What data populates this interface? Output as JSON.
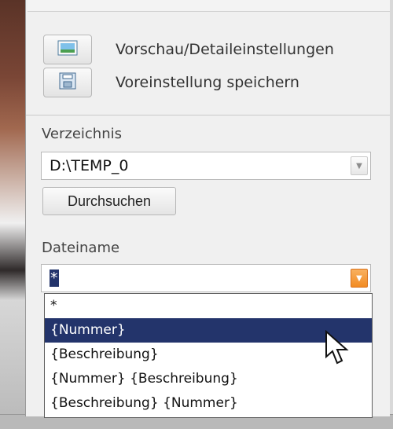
{
  "actions": [
    {
      "label": "Vorschau/Detaileinstellungen",
      "icon": "picture-icon"
    },
    {
      "label": "Voreinstellung speichern",
      "icon": "save-icon"
    }
  ],
  "directory": {
    "label": "Verzeichnis",
    "value": "D:\\TEMP_0",
    "browse_label": "Durchsuchen"
  },
  "filename": {
    "label": "Dateiname",
    "value": "*",
    "options": [
      "*",
      "{Nummer}",
      "{Beschreibung}",
      "{Nummer} {Beschreibung}",
      "{Beschreibung} {Nummer}"
    ],
    "highlighted_option": "{Nummer}"
  },
  "colors": {
    "selection": "#23346b",
    "dropdown_accent": "#f28b22"
  }
}
